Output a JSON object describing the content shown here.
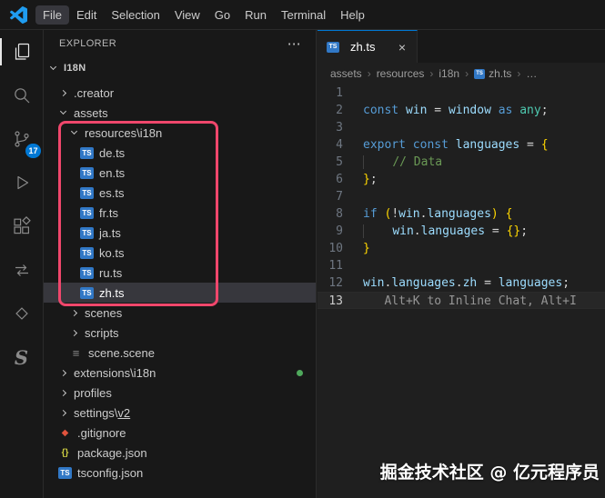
{
  "title_bar": {
    "menus": [
      "File",
      "Edit",
      "Selection",
      "View",
      "Go",
      "Run",
      "Terminal",
      "Help"
    ],
    "active_menu": "File"
  },
  "activity_bar": {
    "items": [
      {
        "id": "explorer",
        "active": true
      },
      {
        "id": "search"
      },
      {
        "id": "source-control",
        "badge": "17"
      },
      {
        "id": "run-and-debug"
      },
      {
        "id": "extensions"
      },
      {
        "id": "extension-swap"
      },
      {
        "id": "extension-diamond"
      },
      {
        "id": "extension-s",
        "glyph": "S"
      }
    ]
  },
  "explorer": {
    "title": "EXPLORER",
    "actions": "⋯",
    "section": "I18N",
    "tree": [
      {
        "type": "folder",
        "depth": 1,
        "expanded": false,
        "label": ".creator"
      },
      {
        "type": "folder",
        "depth": 1,
        "expanded": true,
        "label": "assets"
      },
      {
        "type": "folder",
        "depth": 2,
        "expanded": true,
        "label": "resources\\i18n"
      },
      {
        "type": "file",
        "depth": 3,
        "icon": "ts",
        "label": "de.ts"
      },
      {
        "type": "file",
        "depth": 3,
        "icon": "ts",
        "label": "en.ts"
      },
      {
        "type": "file",
        "depth": 3,
        "icon": "ts",
        "label": "es.ts"
      },
      {
        "type": "file",
        "depth": 3,
        "icon": "ts",
        "label": "fr.ts"
      },
      {
        "type": "file",
        "depth": 3,
        "icon": "ts",
        "label": "ja.ts"
      },
      {
        "type": "file",
        "depth": 3,
        "icon": "ts",
        "label": "ko.ts"
      },
      {
        "type": "file",
        "depth": 3,
        "icon": "ts",
        "label": "ru.ts"
      },
      {
        "type": "file",
        "depth": 3,
        "icon": "ts",
        "label": "zh.ts",
        "selected": true
      },
      {
        "type": "folder",
        "depth": 2,
        "expanded": false,
        "label": "scenes"
      },
      {
        "type": "folder",
        "depth": 2,
        "expanded": false,
        "label": "scripts"
      },
      {
        "type": "file",
        "depth": 2,
        "icon": "scene",
        "label": "scene.scene"
      },
      {
        "type": "folder",
        "depth": 1,
        "expanded": false,
        "label": "extensions\\i18n",
        "dot": true
      },
      {
        "type": "folder",
        "depth": 1,
        "expanded": false,
        "label": "profiles"
      },
      {
        "type": "folder",
        "depth": 1,
        "expanded": false,
        "label": "settings\\",
        "underline_suffix": "v2"
      },
      {
        "type": "file",
        "depth": 1,
        "icon": "git",
        "label": ".gitignore"
      },
      {
        "type": "file",
        "depth": 1,
        "icon": "json",
        "label": "package.json"
      },
      {
        "type": "file",
        "depth": 1,
        "icon": "ts",
        "label": "tsconfig.json"
      }
    ]
  },
  "file_icons": {
    "ts": "TS",
    "scene": "≡",
    "git": "◆",
    "json": "{}"
  },
  "tab": {
    "icon": "TS",
    "label": "zh.ts",
    "close": "×"
  },
  "breadcrumbs": [
    {
      "label": "assets"
    },
    {
      "label": "resources"
    },
    {
      "label": "i18n"
    },
    {
      "label": "zh.ts",
      "icon": "ts"
    },
    {
      "label": "…"
    }
  ],
  "editor": {
    "lines": [
      {
        "n": 1,
        "tokens": []
      },
      {
        "n": 2,
        "tokens": [
          {
            "t": "const ",
            "c": "k"
          },
          {
            "t": "win",
            "c": "v"
          },
          {
            "t": " = ",
            "c": "p"
          },
          {
            "t": "window",
            "c": "v"
          },
          {
            "t": " as ",
            "c": "k"
          },
          {
            "t": "any",
            "c": "t"
          },
          {
            "t": ";",
            "c": "p"
          }
        ]
      },
      {
        "n": 3,
        "tokens": []
      },
      {
        "n": 4,
        "tokens": [
          {
            "t": "export ",
            "c": "k"
          },
          {
            "t": "const ",
            "c": "k"
          },
          {
            "t": "languages",
            "c": "v"
          },
          {
            "t": " = ",
            "c": "p"
          },
          {
            "t": "{",
            "c": "b"
          }
        ]
      },
      {
        "n": 5,
        "tokens": [
          {
            "t": "    ",
            "c": "ind"
          },
          {
            "t": "// Data",
            "c": "c"
          }
        ]
      },
      {
        "n": 6,
        "tokens": [
          {
            "t": "}",
            "c": "b"
          },
          {
            "t": ";",
            "c": "p"
          }
        ]
      },
      {
        "n": 7,
        "tokens": []
      },
      {
        "n": 8,
        "tokens": [
          {
            "t": "if ",
            "c": "k"
          },
          {
            "t": "(",
            "c": "b"
          },
          {
            "t": "!",
            "c": "p"
          },
          {
            "t": "win",
            "c": "v"
          },
          {
            "t": ".",
            "c": "p"
          },
          {
            "t": "languages",
            "c": "v"
          },
          {
            "t": ")",
            "c": "b"
          },
          {
            "t": " ",
            "c": "p"
          },
          {
            "t": "{",
            "c": "b"
          }
        ]
      },
      {
        "n": 9,
        "tokens": [
          {
            "t": "    ",
            "c": "ind"
          },
          {
            "t": "win",
            "c": "v"
          },
          {
            "t": ".",
            "c": "p"
          },
          {
            "t": "languages",
            "c": "v"
          },
          {
            "t": " = ",
            "c": "p"
          },
          {
            "t": "{}",
            "c": "b"
          },
          {
            "t": ";",
            "c": "p"
          }
        ]
      },
      {
        "n": 10,
        "tokens": [
          {
            "t": "}",
            "c": "b"
          }
        ]
      },
      {
        "n": 11,
        "tokens": []
      },
      {
        "n": 12,
        "tokens": [
          {
            "t": "win",
            "c": "v"
          },
          {
            "t": ".",
            "c": "p"
          },
          {
            "t": "languages",
            "c": "v"
          },
          {
            "t": ".",
            "c": "p"
          },
          {
            "t": "zh",
            "c": "v"
          },
          {
            "t": " = ",
            "c": "p"
          },
          {
            "t": "languages",
            "c": "v"
          },
          {
            "t": ";",
            "c": "p"
          }
        ]
      },
      {
        "n": 13,
        "current": true,
        "tokens": [
          {
            "t": "   ",
            "c": "p"
          },
          {
            "t": "Alt+K to Inline Chat, Alt+I",
            "c": "g"
          }
        ]
      }
    ]
  },
  "watermark": "掘金技术社区 @ 亿元程序员",
  "annotation_box": {
    "color": "#f0476c"
  },
  "colors": {
    "ts_icon": "#3178c6",
    "badge": "#0078d4",
    "selection": "#37373d",
    "modified_dot": "#4fa95c",
    "tab_top_border": "#0078d4"
  }
}
